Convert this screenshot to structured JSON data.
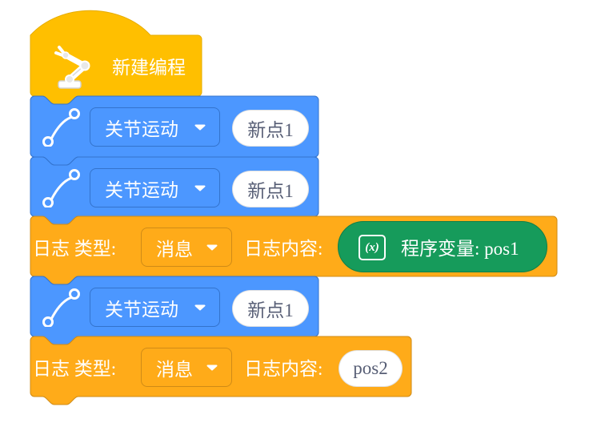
{
  "palette": {
    "hat_fill": "#FFBF00",
    "hat_stroke": "#E6AC00",
    "motion_fill": "#4C97FF",
    "motion_stroke": "#3373CC",
    "log_fill": "#FFAB19",
    "log_stroke": "#CF8B17",
    "variable_fill": "#169B5B",
    "variable_stroke": "#0F7F49",
    "label_text": "#FFFFFF",
    "input_fill": "#FFFFFF",
    "input_text": "#575E75"
  },
  "hat": {
    "icon": "robot-arm-icon",
    "label": "新建编程"
  },
  "blocks": [
    {
      "icon": "path-segment-icon",
      "motion": {
        "value": "关节运动",
        "caret": "dropdown-caret-icon"
      },
      "point": "新点1"
    },
    {
      "icon": "path-segment-icon",
      "motion": {
        "value": "关节运动",
        "caret": "dropdown-caret-icon"
      },
      "point": "新点1"
    },
    {
      "type_label": "日志 类型:",
      "type": {
        "value": "消息",
        "caret": "dropdown-caret-icon"
      },
      "content_label": "日志内容:",
      "content": {
        "icon": "variable-icon",
        "icon_text": "(x)",
        "label": "程序变量: pos1"
      }
    },
    {
      "icon": "path-segment-icon",
      "motion": {
        "value": "关节运动",
        "caret": "dropdown-caret-icon"
      },
      "point": "新点1"
    },
    {
      "type_label": "日志 类型:",
      "type": {
        "value": "消息",
        "caret": "dropdown-caret-icon"
      },
      "content_label": "日志内容:",
      "content": {
        "value": "pos2"
      }
    }
  ]
}
